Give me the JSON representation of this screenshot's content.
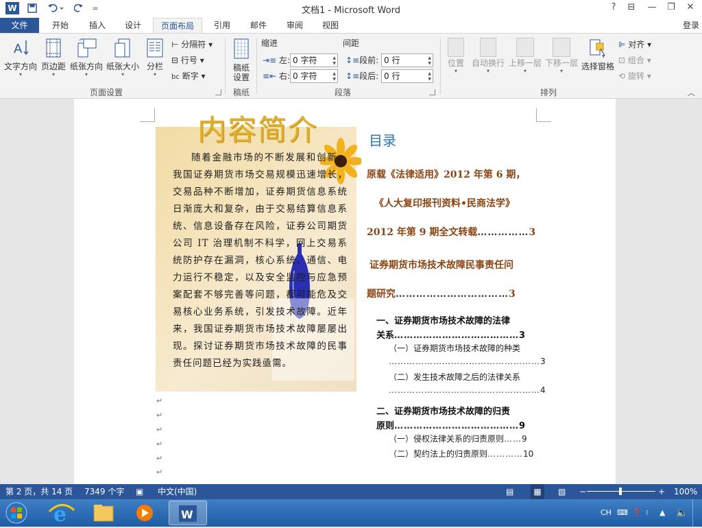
{
  "window": {
    "title": "文档1 - Microsoft Word",
    "help": "?",
    "controls": [
      "?",
      "⊟",
      "—",
      "❐",
      "✕"
    ]
  },
  "quick_access": {
    "word_icon": "W",
    "save_icon": "save-icon",
    "undo_icon": "undo-icon",
    "redo_icon": "redo-icon",
    "customize": "="
  },
  "tabs": [
    "文件",
    "开始",
    "插入",
    "设计",
    "页面布局",
    "引用",
    "邮件",
    "审阅",
    "视图"
  ],
  "active_tab": "页面布局",
  "login": "登录",
  "ribbon": {
    "page_setup": {
      "label": "页面设置",
      "buttons": [
        "文字方向",
        "页边距",
        "纸张方向",
        "纸张大小",
        "分栏"
      ],
      "small": [
        "分隔符",
        "行号",
        "断字"
      ]
    },
    "draft": {
      "label": "稿纸",
      "button": "稿纸\n设置"
    },
    "paragraph": {
      "label": "段落",
      "indent_title": "缩进",
      "spacing_title": "间距",
      "left_label": "左:",
      "right_label": "右:",
      "before_label": "段前:",
      "after_label": "段后:",
      "left_value": "0 字符",
      "right_value": "0 字符",
      "before_value": "0 行",
      "after_value": "0 行"
    },
    "arrange": {
      "label": "排列",
      "buttons": [
        "位置",
        "自动换行",
        "上移一层",
        "下移一层",
        "选择窗格"
      ],
      "small": [
        "对齐",
        "组合",
        "旋转"
      ]
    }
  },
  "document": {
    "panel_title": "内容简介",
    "panel_text": "随着金融市场的不断发展和创新，我国证券期货市场交易规模迅速增长，交易品种不断增加，证券期货信息系统日渐庞大和复杂，由于交易结算信息系统、信息设备存在风险，证券公司期货公司 IT 治理机制不科学，网上交易系统防护存在漏洞，核心系统、通信、电力运行不稳定，以及安全监控与应急预案配套不够完善等问题，都可能危及交易核心业务系统，引发技术故障。近年来，我国证券期货市场技术故障屡屡出现。探讨证券期货市场技术故障的民事责任问题已经为实践亟需。",
    "para_marks": [
      "↵",
      "↵",
      "↵",
      "↵",
      "↵",
      "↵"
    ],
    "toc_title": "目录",
    "toc_bold": [
      "原载《法律适用》2012 年第 6 期，",
      "《人大复印报刊资料•民商法学》",
      "2012 年第 9 期全文转载",
      "证券期货市场技术故障民事责任问",
      "题研究"
    ],
    "toc_bold_pages": [
      "3",
      "3"
    ],
    "toc_h2": [
      {
        "line1": "一、证券期货市场技术故障的法律",
        "line2": "关系",
        "page": "3"
      },
      {
        "line1": "二、证券期货市场技术故障的归责",
        "line2": "原则",
        "page": "9"
      }
    ],
    "toc_h3": [
      {
        "text": "（一）证券期货市场技术故障的种类",
        "page": "3"
      },
      {
        "text": "（二）发生技术故障之后的法律关系",
        "page": "4"
      },
      {
        "text": "（一）侵权法律关系的归责原则",
        "page": "9"
      },
      {
        "text": "（二）契约法上的归责原则",
        "page": "10"
      }
    ]
  },
  "statusbar": {
    "page": "第 2 页，共 14 页",
    "words": "7349 个字",
    "language": "中文(中国)",
    "zoom": "100%",
    "zoom_minus": "−",
    "zoom_plus": "+"
  },
  "taskbar": {
    "tray_lang": "CH"
  },
  "colors": {
    "accent": "#2b579a",
    "toc_bold": "#8b4513",
    "toc_title": "#2e74b5",
    "panel_title": "#e0b02a"
  }
}
